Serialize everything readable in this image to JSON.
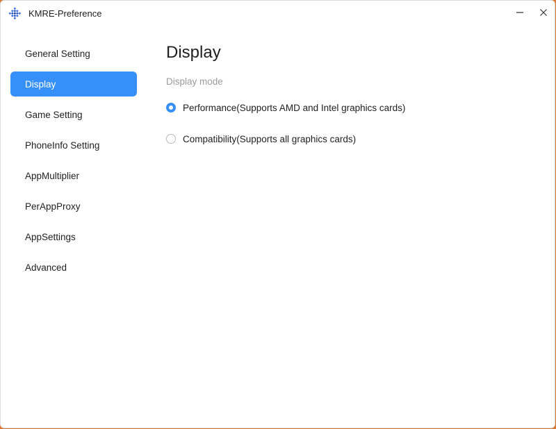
{
  "window": {
    "title": "KMRE-Preference",
    "icon": "kmre-app-icon",
    "minimize_icon": "minimize-icon",
    "close_icon": "close-icon"
  },
  "sidebar": {
    "items": [
      {
        "label": "General Setting",
        "active": false
      },
      {
        "label": "Display",
        "active": true
      },
      {
        "label": "Game Setting",
        "active": false
      },
      {
        "label": "PhoneInfo Setting",
        "active": false
      },
      {
        "label": "AppMultiplier",
        "active": false
      },
      {
        "label": "PerAppProxy",
        "active": false
      },
      {
        "label": "AppSettings",
        "active": false
      },
      {
        "label": "Advanced",
        "active": false
      }
    ]
  },
  "main": {
    "title": "Display",
    "section_label": "Display mode",
    "options": [
      {
        "label": "Performance(Supports AMD and Intel graphics cards)",
        "checked": true
      },
      {
        "label": "Compatibility(Supports all graphics cards)",
        "checked": false
      }
    ]
  },
  "colors": {
    "accent": "#3790fa",
    "text": "#1f1f1f",
    "muted": "#9a9a9a",
    "desktop": "#d9772e"
  }
}
